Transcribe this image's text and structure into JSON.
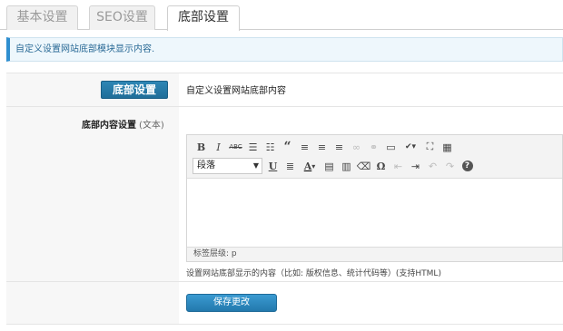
{
  "tabs": [
    {
      "label": "基本设置"
    },
    {
      "label": "SEO设置"
    },
    {
      "label": "底部设置"
    }
  ],
  "notice": "自定义设置网站底部模块显示内容.",
  "section": {
    "button_label": "底部设置",
    "description": "自定义设置网站底部内容"
  },
  "footer_content": {
    "label": "底部内容设置",
    "label_hint": "(文本)",
    "format_select": "段落",
    "status_path": "标签层级: p",
    "hint": "设置网站底部显示的内容（比如: 版权信息、统计代码等）(支持HTML)"
  },
  "toolbar": {
    "row1": [
      {
        "icon": "bold-icon",
        "glyph": "B"
      },
      {
        "icon": "italic-icon",
        "glyph": "I"
      },
      {
        "icon": "strikethrough-icon",
        "glyph": "ABC"
      },
      {
        "icon": "bullet-list-icon",
        "glyph": "☰"
      },
      {
        "icon": "numbered-list-icon",
        "glyph": "☷"
      },
      {
        "icon": "blockquote-icon",
        "glyph": "“"
      },
      {
        "icon": "align-left-icon",
        "glyph": "≡"
      },
      {
        "icon": "align-center-icon",
        "glyph": "≡"
      },
      {
        "icon": "align-right-icon",
        "glyph": "≡"
      },
      {
        "icon": "link-icon",
        "glyph": "∞"
      },
      {
        "icon": "unlink-icon",
        "glyph": "⚭"
      },
      {
        "icon": "more-tag-icon",
        "glyph": "▭"
      },
      {
        "icon": "spellcheck-icon",
        "glyph": "✔▾"
      },
      {
        "icon": "fullscreen-icon",
        "glyph": "⛶"
      },
      {
        "icon": "kitchen-sink-icon",
        "glyph": "▦"
      }
    ],
    "row2": [
      {
        "icon": "underline-icon",
        "glyph": "U"
      },
      {
        "icon": "justify-icon",
        "glyph": "≣"
      },
      {
        "icon": "text-color-icon",
        "glyph": "A▾"
      },
      {
        "icon": "paste-text-icon",
        "glyph": "📋"
      },
      {
        "icon": "paste-word-icon",
        "glyph": "📄"
      },
      {
        "icon": "clear-format-icon",
        "glyph": "⌫"
      },
      {
        "icon": "special-char-icon",
        "glyph": "Ω"
      },
      {
        "icon": "outdent-icon",
        "glyph": "⇤"
      },
      {
        "icon": "indent-icon",
        "glyph": "⇥"
      },
      {
        "icon": "undo-icon",
        "glyph": "↶"
      },
      {
        "icon": "redo-icon",
        "glyph": "↷"
      },
      {
        "icon": "help-icon",
        "glyph": "?"
      }
    ]
  },
  "save_label": "保存更改"
}
